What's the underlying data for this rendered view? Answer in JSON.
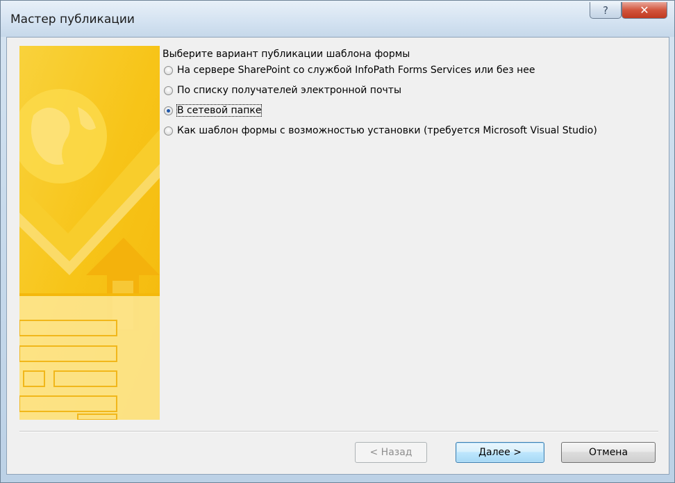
{
  "window": {
    "title": "Мастер публикации",
    "help_glyph": "?",
    "close_glyph": "✕"
  },
  "content": {
    "prompt": "Выберите вариант публикации шаблона формы",
    "options": [
      {
        "label": "На сервере SharePoint со службой InfoPath Forms Services или без нее",
        "checked": false
      },
      {
        "label": "По списку получателей электронной почты",
        "checked": false
      },
      {
        "label": "В сетевой папке",
        "checked": true
      },
      {
        "label": "Как шаблон формы с возможностью установки (требуется Microsoft Visual Studio)",
        "checked": false
      }
    ]
  },
  "buttons": {
    "back": "< Назад",
    "next": "Далее >",
    "cancel": "Отмена"
  },
  "colors": {
    "banner_yellow": "#f7c418",
    "banner_light": "#fde98a",
    "default_button_border": "#3c7fb1",
    "close_red": "#c8452a"
  }
}
